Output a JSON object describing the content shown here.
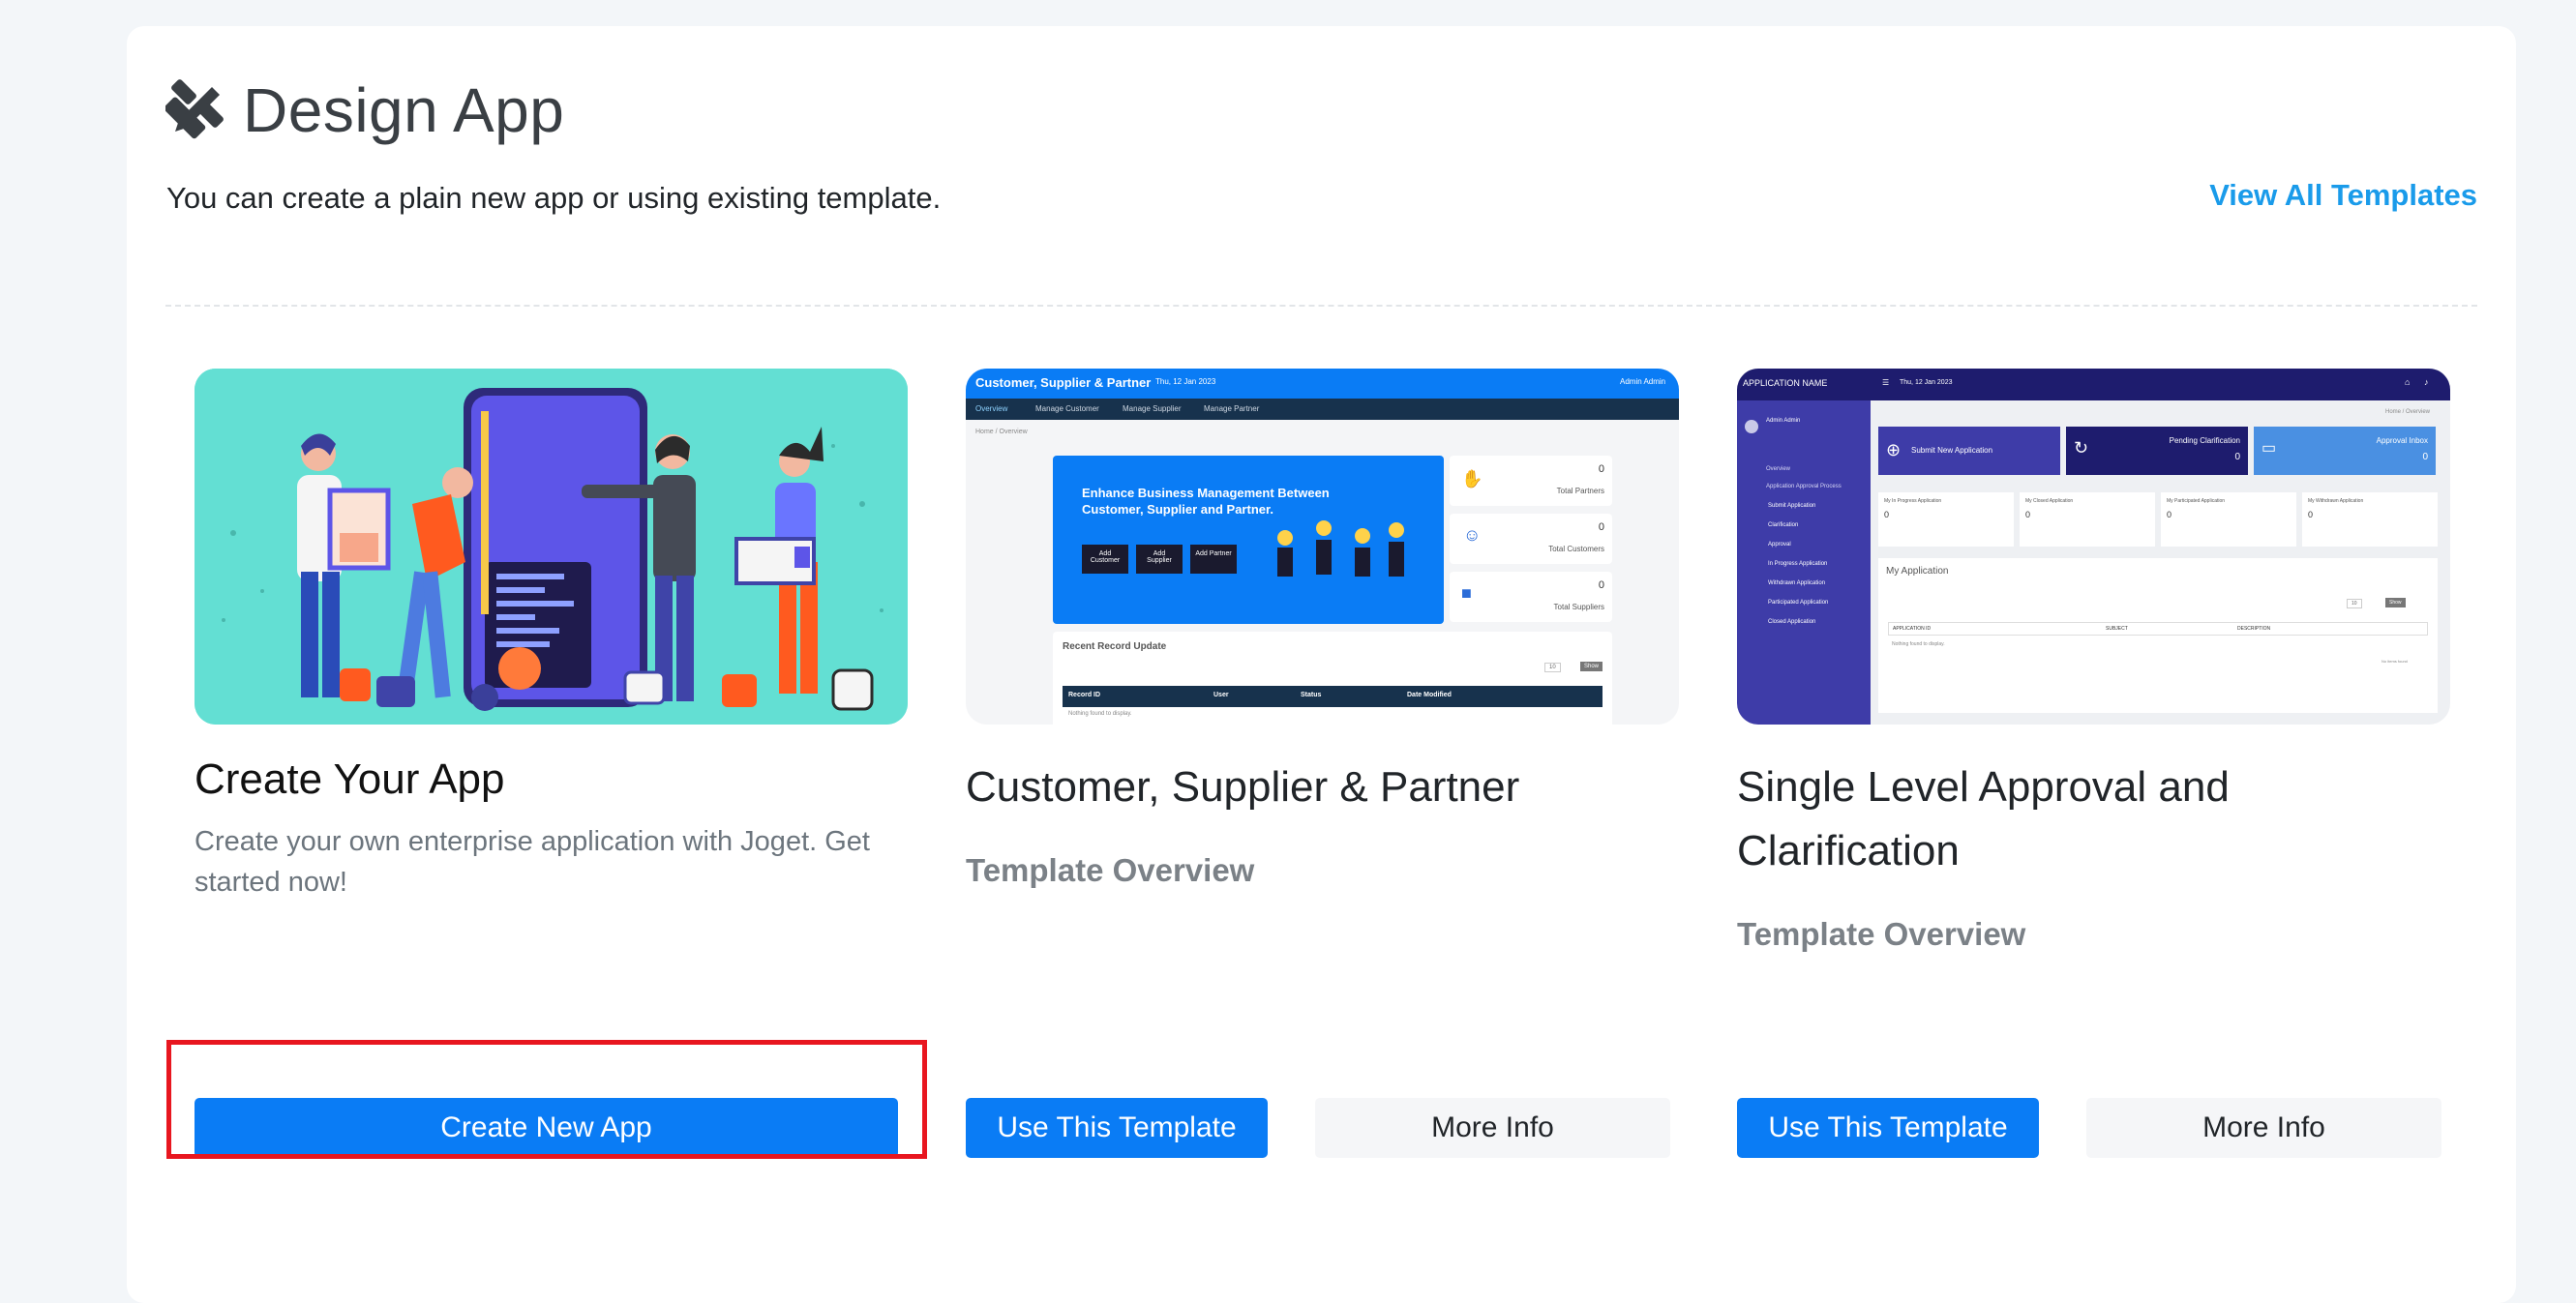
{
  "header": {
    "title": "Design App",
    "subtitle": "You can create a plain new app or using existing template.",
    "view_all_label": "View All Templates"
  },
  "cards": [
    {
      "title": "Create Your App",
      "description": "Create your own enterprise application with Joget. Get started now!",
      "primary_button": "Create New App"
    },
    {
      "title": "Customer, Supplier & Partner",
      "overview_label": "Template Overview",
      "primary_button": "Use This Template",
      "secondary_button": "More Info",
      "preview": {
        "app_title": "Customer, Supplier & Partner",
        "date": "Thu, 12 Jan 2023",
        "user": "Admin Admin",
        "tabs": [
          "Overview",
          "Manage Customer",
          "Manage Supplier",
          "Manage Partner"
        ],
        "breadcrumb": "Home / Overview",
        "banner_text": "Enhance Business Management Between Customer, Supplier and Partner.",
        "banner_buttons": [
          "Add Customer",
          "Add Supplier",
          "Add Partner"
        ],
        "stats": [
          {
            "value": "0",
            "label": "Total Partners"
          },
          {
            "value": "0",
            "label": "Total Customers"
          },
          {
            "value": "0",
            "label": "Total Suppliers"
          }
        ],
        "recent_title": "Recent Record Update",
        "page_size": "10",
        "show_label": "Show",
        "columns": [
          "Record ID",
          "User",
          "Status",
          "Date Modified"
        ],
        "empty_text": "Nothing found to display."
      }
    },
    {
      "title": "Single Level Approval and Clarification",
      "overview_label": "Template Overview",
      "primary_button": "Use This Template",
      "secondary_button": "More Info",
      "preview": {
        "app_name": "APPLICATION NAME",
        "date": "Thu, 12 Jan 2023",
        "user": "Admin Admin",
        "menu": [
          "Overview",
          "Application Approval Process",
          "Submit Application",
          "Clarification",
          "Approval",
          "In Progress Application",
          "Withdrawn Application",
          "Participated Application",
          "Closed Application"
        ],
        "breadcrumb": "Home / Overview",
        "tiles": [
          "Submit New Application",
          "Pending Clarification",
          "Approval Inbox"
        ],
        "tile_counts": [
          "",
          "0",
          "0"
        ],
        "stat_labels": [
          "My In Progress Application",
          "My Closed Application",
          "My Participated Application",
          "My Withdrawn Application"
        ],
        "stat_values": [
          "0",
          "0",
          "0",
          "0"
        ],
        "section_title": "My Application",
        "page_size": "10",
        "show_label": "Show",
        "columns": [
          "APPLICATION ID",
          "SUBJECT",
          "DESCRIPTION"
        ],
        "empty_text": "Nothing found to display.",
        "no_items": "No items found"
      }
    }
  ],
  "colors": {
    "accent": "#0a7cf5",
    "link": "#1a9bea",
    "highlight": "#e8161f",
    "illustration_bg": "#63dfd3"
  }
}
